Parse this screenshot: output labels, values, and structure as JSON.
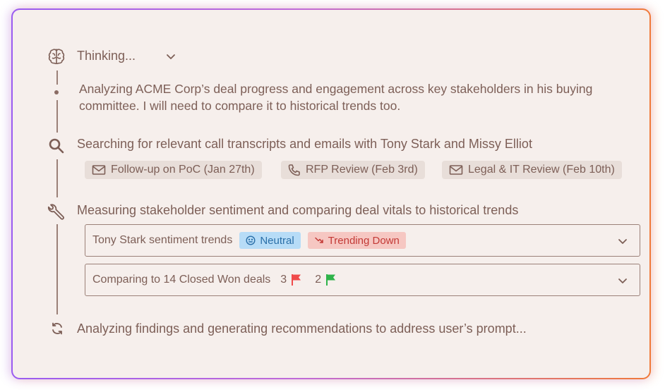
{
  "thinking": {
    "label": "Thinking..."
  },
  "analysis_text": "Analyzing ACME Corp’s deal progress and engagement across key stakeholders in his buying committee. I will need to compare it to historical trends too.",
  "search": {
    "text": "Searching for relevant call transcripts and emails with Tony Stark and Missy Elliot",
    "chips": [
      {
        "label": "Follow-up on PoC (Jan 27th)",
        "icon": "mail-icon"
      },
      {
        "label": "RFP Review (Feb 3rd)",
        "icon": "phone-icon"
      },
      {
        "label": "Legal & IT Review (Feb 10th)",
        "icon": "mail-icon"
      }
    ]
  },
  "measure": {
    "text": "Measuring stakeholder sentiment and comparing deal vitals to historical trends",
    "sentiment_row": {
      "label": "Tony Stark sentiment trends",
      "badge_neutral": "Neutral",
      "badge_down": "Trending Down"
    },
    "comparison_row": {
      "label": "Comparing to 14 Closed Won deals",
      "red_count": "3",
      "green_count": "2"
    }
  },
  "final_step": {
    "text": "Analyzing findings and generating recommendations to address user’s prompt..."
  },
  "colors": {
    "neutral": "#2a6fa8",
    "trending_down": "#c33a36",
    "red_flag": "#f04b4b",
    "green_flag": "#2fb34a"
  }
}
